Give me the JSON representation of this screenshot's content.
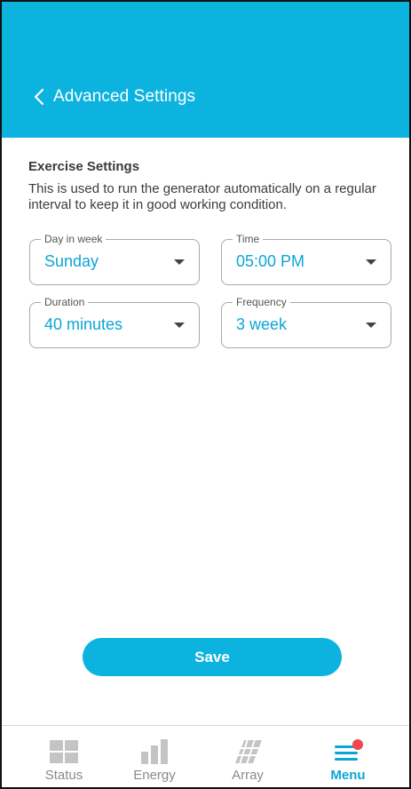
{
  "header": {
    "title": "Advanced Settings",
    "color": "#0db3df"
  },
  "section": {
    "title": "Exercise Settings",
    "description": "This is used to run the generator automatically on a regular interval to keep it in good working condition."
  },
  "fields": {
    "day": {
      "label": "Day in week",
      "value": "Sunday"
    },
    "time": {
      "label": "Time",
      "value": "05:00 PM"
    },
    "duration": {
      "label": "Duration",
      "value": "40 minutes"
    },
    "frequency": {
      "label": "Frequency",
      "value": "3 week"
    }
  },
  "save": {
    "label": "Save"
  },
  "nav": {
    "items": [
      {
        "label": "Status",
        "icon": "grid-icon",
        "active": false
      },
      {
        "label": "Energy",
        "icon": "bar-chart-icon",
        "active": false
      },
      {
        "label": "Array",
        "icon": "solar-array-icon",
        "active": false
      },
      {
        "label": "Menu",
        "icon": "menu-icon",
        "active": true,
        "badge_color": "#f0474f"
      }
    ]
  },
  "colors": {
    "accent": "#0aa6d6",
    "inactive": "#c4c4c4",
    "badge": "#f0474f"
  }
}
